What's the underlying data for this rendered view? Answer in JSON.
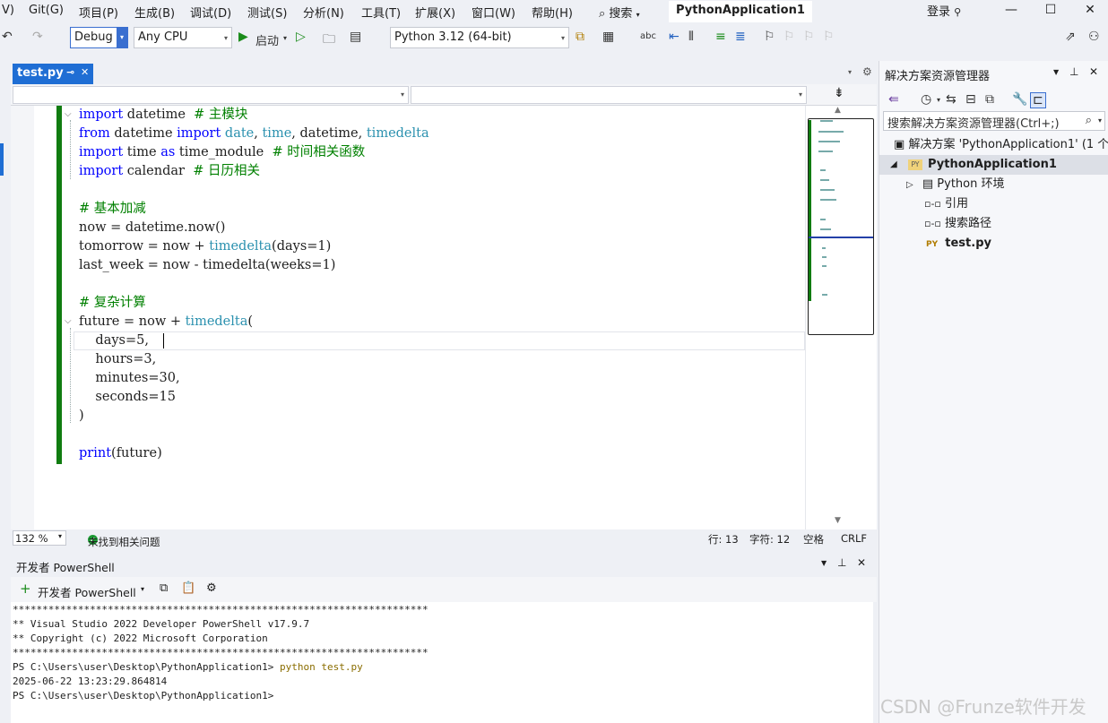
{
  "menu": {
    "items": [
      "V)",
      "Git(G)",
      "项目(P)",
      "生成(B)",
      "调试(D)",
      "测试(S)",
      "分析(N)",
      "工具(T)",
      "扩展(X)",
      "窗口(W)",
      "帮助(H)"
    ],
    "search_label": "搜索",
    "window_title": "PythonApplication1",
    "login": "登录"
  },
  "toolbar": {
    "config": "Debug",
    "platform": "Any CPU",
    "start_label": "启动",
    "python_env": "Python 3.12 (64-bit)"
  },
  "editor": {
    "tab_label": "test.py",
    "code_lines": [
      [
        [
          "kw",
          "import"
        ],
        [
          "tx",
          " datetime  "
        ],
        [
          "cm",
          "# 主模块"
        ]
      ],
      [
        [
          "kw",
          "from"
        ],
        [
          "tx",
          " datetime "
        ],
        [
          "kw",
          "import"
        ],
        [
          "tx",
          " "
        ],
        [
          "ty",
          "date"
        ],
        [
          "tx",
          ", "
        ],
        [
          "ty",
          "time"
        ],
        [
          "tx",
          ", datetime, "
        ],
        [
          "ty",
          "timedelta"
        ]
      ],
      [
        [
          "kw",
          "import"
        ],
        [
          "tx",
          " time "
        ],
        [
          "kw",
          "as"
        ],
        [
          "tx",
          " time_module  "
        ],
        [
          "cm",
          "# 时间相关函数"
        ]
      ],
      [
        [
          "kw",
          "import"
        ],
        [
          "tx",
          " calendar  "
        ],
        [
          "cm",
          "# 日历相关"
        ]
      ],
      [],
      [
        [
          "cm",
          "# 基本加减"
        ]
      ],
      [
        [
          "tx",
          "now = datetime.now()"
        ]
      ],
      [
        [
          "tx",
          "tomorrow = now + "
        ],
        [
          "ty",
          "timedelta"
        ],
        [
          "tx",
          "(days=1)"
        ]
      ],
      [
        [
          "tx",
          "last_week = now - timedelta(weeks=1)"
        ]
      ],
      [],
      [
        [
          "cm",
          "# 复杂计算"
        ]
      ],
      [
        [
          "tx",
          "future = now + "
        ],
        [
          "ty",
          "timedelta"
        ],
        [
          "tx",
          "("
        ]
      ],
      [
        [
          "tx",
          "    days=5,"
        ]
      ],
      [
        [
          "tx",
          "    hours=3,"
        ]
      ],
      [
        [
          "tx",
          "    minutes=30,"
        ]
      ],
      [
        [
          "tx",
          "    seconds=15"
        ]
      ],
      [
        [
          "tx",
          ")"
        ]
      ],
      [],
      [
        [
          "kw",
          "print"
        ],
        [
          "tx",
          "(future)"
        ]
      ]
    ]
  },
  "status": {
    "zoom": "132 %",
    "issues": "未找到相关问题",
    "line": "行: 13",
    "char": "字符: 12",
    "indent": "空格",
    "eol": "CRLF"
  },
  "solution_explorer": {
    "title": "解决方案资源管理器",
    "search_placeholder": "搜索解决方案资源管理器(Ctrl+;)",
    "solution": "解决方案 'PythonApplication1' (1 个",
    "project": "PythonApplication1",
    "project_badge": "PY",
    "env": "Python 环境",
    "refs": "引用",
    "search_paths": "搜索路径",
    "file": "test.py",
    "file_badge": "PY"
  },
  "powershell": {
    "title": "开发者 PowerShell",
    "new_label": "开发者 PowerShell",
    "lines": [
      "**********************************************************************",
      "** Visual Studio 2022 Developer PowerShell v17.9.7",
      "** Copyright (c) 2022 Microsoft Corporation",
      "**********************************************************************"
    ],
    "prompt1": "PS C:\\Users\\user\\Desktop\\PythonApplication1> ",
    "command": "python test.py",
    "output": "2025-06-22 13:23:29.864814",
    "prompt2": "PS C:\\Users\\user\\Desktop\\PythonApplication1>"
  },
  "watermark": "CSDN @Frunze软件开发"
}
